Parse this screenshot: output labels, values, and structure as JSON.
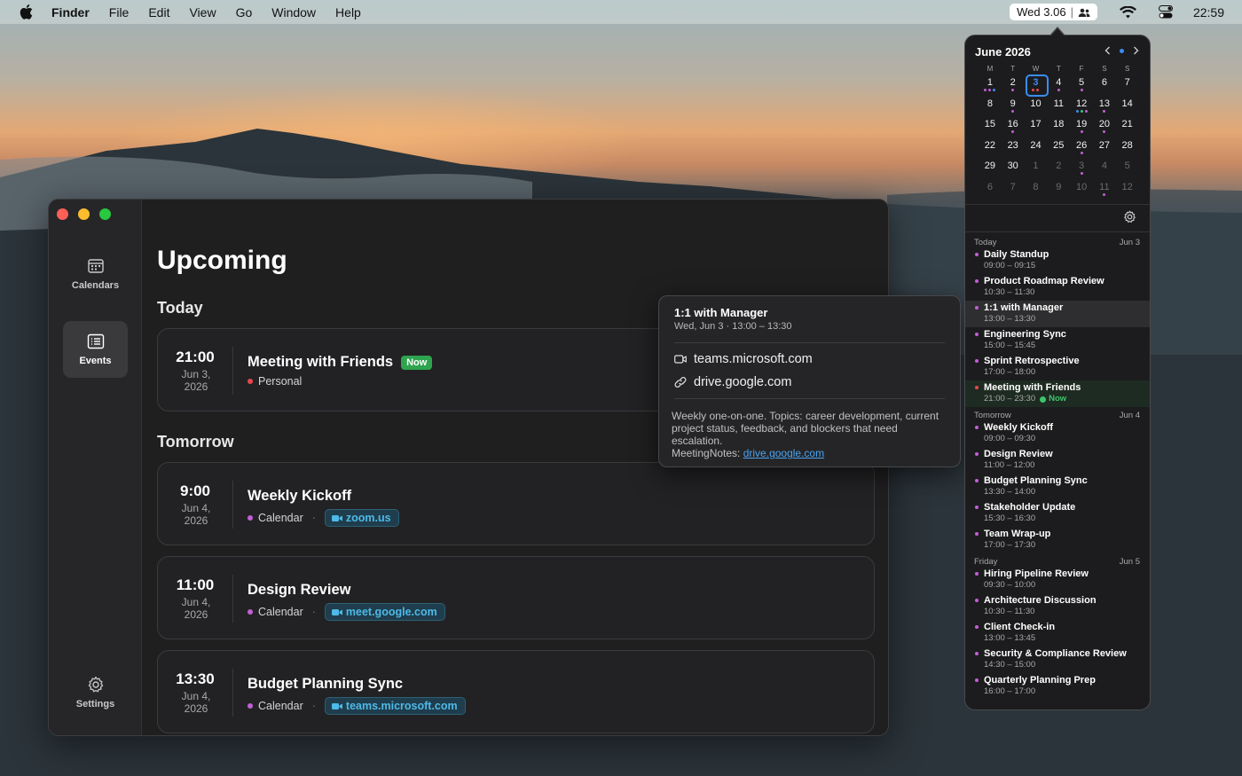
{
  "menubar": {
    "app": "Finder",
    "items": [
      "File",
      "Edit",
      "View",
      "Go",
      "Window",
      "Help"
    ],
    "status_cal": "Wed 3.06",
    "clock": "22:59"
  },
  "sidebar": {
    "calendars_label": "Calendars",
    "events_label": "Events",
    "settings_label": "Settings"
  },
  "main": {
    "title": "Upcoming",
    "today_heading": "Today",
    "tomorrow_heading": "Tomorrow",
    "cards": [
      {
        "time": "21:00",
        "date_line1": "Jun 3,",
        "date_line2": "2026",
        "title": "Meeting with Friends",
        "badge": "Now",
        "calendar": "Personal",
        "dot_color": "#e5484d",
        "link": ""
      },
      {
        "time": "9:00",
        "date_line1": "Jun 4,",
        "date_line2": "2026",
        "title": "Weekly Kickoff",
        "badge": "",
        "calendar": "Calendar",
        "dot_color": "#c35fd6",
        "link": "zoom.us"
      },
      {
        "time": "11:00",
        "date_line1": "Jun 4,",
        "date_line2": "2026",
        "title": "Design Review",
        "badge": "",
        "calendar": "Calendar",
        "dot_color": "#c35fd6",
        "link": "meet.google.com"
      },
      {
        "time": "13:30",
        "date_line1": "Jun 4,",
        "date_line2": "2026",
        "title": "Budget Planning Sync",
        "badge": "",
        "calendar": "Calendar",
        "dot_color": "#c35fd6",
        "link": "teams.microsoft.com"
      }
    ]
  },
  "popover": {
    "title": "1:1 with Manager",
    "subtitle": "Wed, Jun 3 · 13:00 – 13:30",
    "link1": "teams.microsoft.com",
    "link2": "drive.google.com",
    "notes": "Weekly one-on-one. Topics: career development, current project status, feedback, and blockers that need escalation.",
    "notes_prefix": "MeetingNotes:",
    "notes_link": "drive.google.com"
  },
  "panel": {
    "month": "June 2026",
    "weekdays": [
      "M",
      "T",
      "W",
      "T",
      "F",
      "S",
      "S"
    ],
    "weeks": [
      [
        "1",
        "2",
        "3",
        "4",
        "5",
        "6",
        "7"
      ],
      [
        "8",
        "9",
        "10",
        "11",
        "12",
        "13",
        "14"
      ],
      [
        "15",
        "16",
        "17",
        "18",
        "19",
        "20",
        "21"
      ],
      [
        "22",
        "23",
        "24",
        "25",
        "26",
        "27",
        "28"
      ],
      [
        "29",
        "30",
        "1",
        "2",
        "3",
        "4",
        "5"
      ],
      [
        "6",
        "7",
        "8",
        "9",
        "10",
        "11",
        "12"
      ]
    ],
    "groups": [
      {
        "label": "Today",
        "date": "Jun 3",
        "events": [
          {
            "title": "Daily Standup",
            "when": "09:00 – 09:15",
            "color": "#c35fd6"
          },
          {
            "title": "Product Roadmap Review",
            "when": "10:30 – 11:30",
            "color": "#c35fd6"
          },
          {
            "title": "1:1 with Manager",
            "when": "13:00 – 13:30",
            "color": "#c35fd6",
            "state": "hl"
          },
          {
            "title": "Engineering Sync",
            "when": "15:00 – 15:45",
            "color": "#c35fd6"
          },
          {
            "title": "Sprint Retrospective",
            "when": "17:00 – 18:00",
            "color": "#c35fd6"
          },
          {
            "title": "Meeting with Friends",
            "when": "21:00 – 23:30",
            "color": "#e5484d",
            "state": "now",
            "now": "Now"
          }
        ]
      },
      {
        "label": "Tomorrow",
        "date": "Jun 4",
        "events": [
          {
            "title": "Weekly Kickoff",
            "when": "09:00 – 09:30",
            "color": "#c35fd6"
          },
          {
            "title": "Design Review",
            "when": "11:00 – 12:00",
            "color": "#c35fd6"
          },
          {
            "title": "Budget Planning Sync",
            "when": "13:30 – 14:00",
            "color": "#c35fd6"
          },
          {
            "title": "Stakeholder Update",
            "when": "15:30 – 16:30",
            "color": "#c35fd6"
          },
          {
            "title": "Team Wrap-up",
            "when": "17:00 – 17:30",
            "color": "#c35fd6"
          }
        ]
      },
      {
        "label": "Friday",
        "date": "Jun 5",
        "events": [
          {
            "title": "Hiring Pipeline Review",
            "when": "09:30 – 10:00",
            "color": "#c35fd6"
          },
          {
            "title": "Architecture Discussion",
            "when": "10:30 – 11:30",
            "color": "#c35fd6"
          },
          {
            "title": "Client Check-in",
            "when": "13:00 – 13:45",
            "color": "#c35fd6"
          },
          {
            "title": "Security & Compliance Review",
            "when": "14:30 – 15:00",
            "color": "#c35fd6"
          },
          {
            "title": "Quarterly Planning Prep",
            "when": "16:00 – 17:00",
            "color": "#c35fd6"
          }
        ]
      }
    ]
  }
}
